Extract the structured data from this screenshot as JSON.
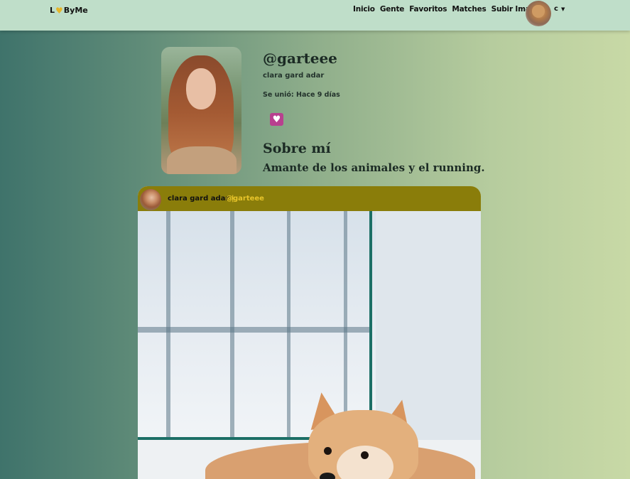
{
  "navbar": {
    "brand_prefix": "L",
    "brand_suffix": "ByMe",
    "brand_icon": "heart-icon",
    "links": [
      "Inicio",
      "Gente",
      "Favoritos",
      "Matches",
      "Subir Imagen"
    ],
    "user_initial": "c"
  },
  "profile": {
    "username": "@garteee",
    "fullname": "clara gard adar",
    "joined": "Se unió: Hace 9 días",
    "like_icon": "heart-icon",
    "about_title": "Sobre mí",
    "about_text": "Amante de los animales y el running."
  },
  "post": {
    "author": "clara gard adar",
    "separator": "|",
    "handle": "@garteee"
  },
  "colors": {
    "navbar_bg": "#bfdec9",
    "accent_gold": "#e5b62a",
    "post_header_bg": "#8a7d0a",
    "like_button_bg": "#b8408f"
  }
}
